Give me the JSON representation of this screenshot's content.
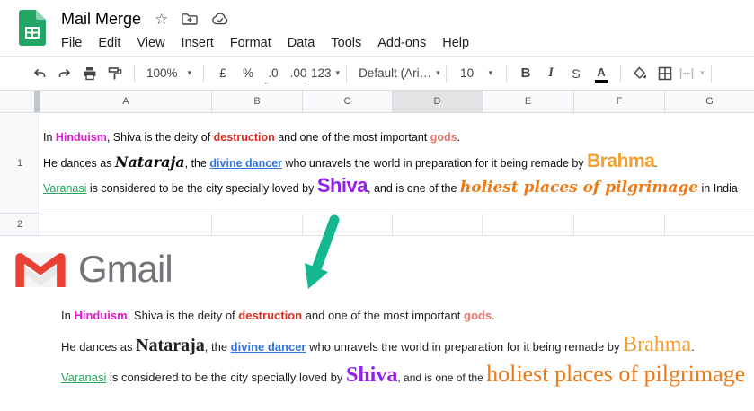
{
  "titlebar": {
    "doc_title": "Mail Merge",
    "icons": [
      "star-icon",
      "move-folder-icon",
      "cloud-saved-icon"
    ]
  },
  "menu": {
    "items": [
      "File",
      "Edit",
      "View",
      "Insert",
      "Format",
      "Data",
      "Tools",
      "Add-ons",
      "Help"
    ]
  },
  "toolbar": {
    "zoom_value": "100%",
    "currency_label": "£",
    "percent_label": "%",
    "decrease_decimals_label": ".0",
    "increase_decimals_label": ".00",
    "more_formats_label": "123",
    "font_value": "Default (Ari…",
    "font_size_value": "10",
    "bold_label": "B",
    "italic_label": "I",
    "strikethrough_label": "S",
    "text_color_label": "A"
  },
  "grid": {
    "columns": [
      "A",
      "B",
      "C",
      "D",
      "E",
      "F",
      "G"
    ],
    "selected_column": "D",
    "rows": [
      "1",
      "2"
    ]
  },
  "sheet_cell": {
    "lines": [
      {
        "segments": [
          {
            "text": "In ",
            "style": "plain"
          },
          {
            "text": "Hinduism",
            "style": "magenta-bold"
          },
          {
            "text": ", Shiva is the deity of ",
            "style": "plain"
          },
          {
            "text": "destruction",
            "style": "red-bold"
          },
          {
            "text": " and one of the most important ",
            "style": "plain"
          },
          {
            "text": "gods",
            "style": "coral-bold"
          },
          {
            "text": ".",
            "style": "plain"
          }
        ]
      },
      {
        "segments": [
          {
            "text": "He dances as ",
            "style": "plain"
          },
          {
            "text": "Nataraja",
            "style": "script-italic"
          },
          {
            "text": ", the ",
            "style": "plain"
          },
          {
            "text": "divine dancer",
            "style": "blue-link"
          },
          {
            "text": " who unravels the world in preparation for it being remade by ",
            "style": "plain"
          },
          {
            "text": "Brahma",
            "style": "orange-display"
          },
          {
            "text": ".",
            "style": "plain"
          }
        ]
      },
      {
        "segments": [
          {
            "text": "Varanasi",
            "style": "green-link"
          },
          {
            "text": " is considered to be the city specially loved by ",
            "style": "plain"
          },
          {
            "text": "Shiva",
            "style": "purple-display"
          },
          {
            "text": ", and is one of the ",
            "style": "plain"
          },
          {
            "text": "holiest places of pilgrimage",
            "style": "orange-script"
          },
          {
            "text": " in India",
            "style": "plain"
          }
        ]
      }
    ]
  },
  "gmail": {
    "wordmark": "Gmail",
    "lines": [
      {
        "segments": [
          {
            "text": "In ",
            "style": "plain"
          },
          {
            "text": "Hinduism",
            "style": "magenta-bold"
          },
          {
            "text": ", Shiva is the deity of ",
            "style": "plain"
          },
          {
            "text": "destruction",
            "style": "red-bold"
          },
          {
            "text": " and one of the most important ",
            "style": "plain"
          },
          {
            "text": "gods",
            "style": "coral-bold"
          },
          {
            "text": ".",
            "style": "plain"
          }
        ]
      },
      {
        "segments": [
          {
            "text": "He dances as ",
            "style": "plain"
          },
          {
            "text": "Nataraja",
            "style": "serif-bold"
          },
          {
            "text": ", the ",
            "style": "plain"
          },
          {
            "text": "divine dancer",
            "style": "blue-link"
          },
          {
            "text": " who unravels the world in preparation for it being remade by ",
            "style": "plain"
          },
          {
            "text": "Brahma",
            "style": "orange-serif"
          },
          {
            "text": ".",
            "style": "plain"
          }
        ]
      },
      {
        "segments": [
          {
            "text": "Varanasi",
            "style": "green-link"
          },
          {
            "text": " is considered to be the city specially loved by ",
            "style": "plain"
          },
          {
            "text": "Shiva",
            "style": "purple-serif"
          },
          {
            "text": ", and is one of the ",
            "style": "plain-small"
          },
          {
            "text": "holiest places of pilgrimage",
            "style": "orange-serif-large"
          }
        ]
      }
    ]
  },
  "colors": {
    "sheets_logo_green": "#23a566",
    "gmail_red": "#e94235",
    "gmail_wordmark_gray": "#72767a",
    "arrow_teal": "#14b78f",
    "magenta": "#e619d0",
    "red": "#e02b20",
    "coral": "#e8756a",
    "link_blue": "#2f72e0",
    "link_green": "#26a45a",
    "orange": "#f2a033",
    "deep_orange": "#ee7a16",
    "purple": "#9320e6",
    "column_header_bg": "#f8f9fa",
    "selected_column_bg": "#e2e3e4",
    "grid_line": "#e2e3e3"
  }
}
